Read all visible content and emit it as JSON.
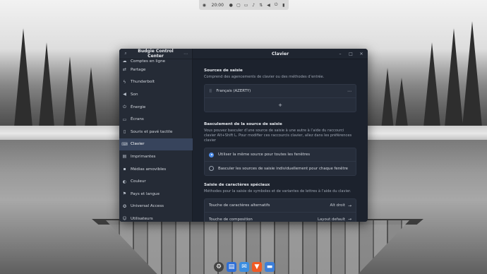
{
  "top_panel": {
    "clock": "20:00",
    "icons": [
      "menu-icon",
      "clock",
      "notification-icon",
      "screenshot-icon",
      "folder-icon",
      "bell-icon",
      "network-icon",
      "volume-icon",
      "power-icon",
      "battery-icon"
    ]
  },
  "sidebar": {
    "title": "Budgie Control Center",
    "items": [
      {
        "label": "Comptes en ligne",
        "icon": "cloud-icon"
      },
      {
        "label": "Partage",
        "icon": "share-icon"
      },
      {
        "label": "Thunderbolt",
        "icon": "thunderbolt-icon"
      },
      {
        "label": "Son",
        "icon": "speaker-icon"
      },
      {
        "label": "Énergie",
        "icon": "power-icon"
      },
      {
        "label": "Écrans",
        "icon": "display-icon"
      },
      {
        "label": "Souris et pavé tactile",
        "icon": "mouse-icon"
      },
      {
        "label": "Clavier",
        "icon": "keyboard-icon",
        "active": true
      },
      {
        "label": "Imprimantes",
        "icon": "printer-icon"
      },
      {
        "label": "Médias amovibles",
        "icon": "media-icon"
      },
      {
        "label": "Couleur",
        "icon": "color-icon"
      },
      {
        "label": "Pays et langue",
        "icon": "language-icon"
      },
      {
        "label": "Universal Access",
        "icon": "accessibility-icon"
      },
      {
        "label": "Utilisateurs",
        "icon": "users-icon"
      }
    ]
  },
  "main": {
    "title": "Clavier",
    "sections": {
      "input_sources": {
        "title": "Sources de saisie",
        "desc": "Comprend des agencements de clavier ou des méthodes d’entrée.",
        "source": "Français (AZERTY)",
        "add": "+"
      },
      "switching": {
        "title": "Basculement de la source de saisie",
        "desc": "Vous pouvez basculer d’une source de saisie à une autre à l’aide du raccourci clavier Alt+Shift L. Pour modifier ces raccourcis clavier, allez dans les préférences clavier",
        "option_same": "Utiliser la même source pour toutes les fenêtres",
        "option_each": "Basculer les sources de saisie individuellement pour chaque fenêtre"
      },
      "special": {
        "title": "Saisie de caractères spéciaux",
        "desc": "Méthodes pour la saisie de symboles et de variantes de lettres à l’aide du clavier.",
        "alt_label": "Touche de caractères alternatifs",
        "alt_value": "Alt droit",
        "compose_label": "Touche de composition",
        "compose_value": "Layout default"
      }
    }
  },
  "dock": {
    "icons": [
      "settings-icon",
      "file-manager-icon",
      "mail-icon",
      "brave-browser-icon",
      "folder-icon"
    ]
  }
}
